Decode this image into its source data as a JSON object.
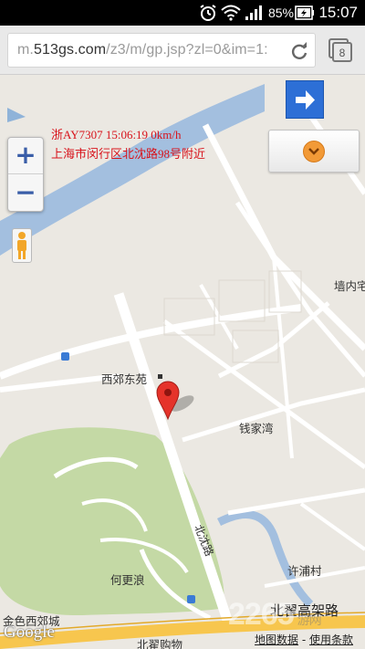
{
  "status_bar": {
    "battery_percent": "85%",
    "time": "15:07"
  },
  "browser": {
    "url_prefix": "m.",
    "url_host": "513gs.com",
    "url_path": "/z3/m/gp.jsp?zl=0&im=1:",
    "tab_count": "8"
  },
  "vehicle_info": {
    "line1": "浙AY7307 15:06:19 0km/h",
    "line2": "上海市闵行区北沈路98号附近"
  },
  "map_controls": {
    "zoom_in": "+",
    "zoom_out": "−"
  },
  "map_labels": {
    "qiangnei": "墙内宅",
    "xijiao_dongyuan": "西郊东苑",
    "qianjiawan": "钱家湾",
    "beishen_road": "北沈路",
    "xupu_village": "许浦村",
    "hegenglang": "何更浪",
    "jinse_xijiaocheng": "金色西郊城",
    "beizhai_expressway": "北翟高架路",
    "beizhai_shopping": "北翟购物"
  },
  "footer": {
    "logo": "Google",
    "map_data": "地图数据",
    "separator": " - ",
    "terms": "使用条款"
  },
  "watermark": {
    "main": "2265",
    "sub": "游网"
  },
  "colors": {
    "river": "#a3bfdf",
    "park": "#c4d9a5",
    "road": "#ffffff",
    "highway": "#f7c64e",
    "land": "#ebe8e2",
    "marker": "#e5332a",
    "info_text": "#d8141c",
    "button_blue": "#2d6fd6",
    "button_orange": "#f29a37"
  }
}
